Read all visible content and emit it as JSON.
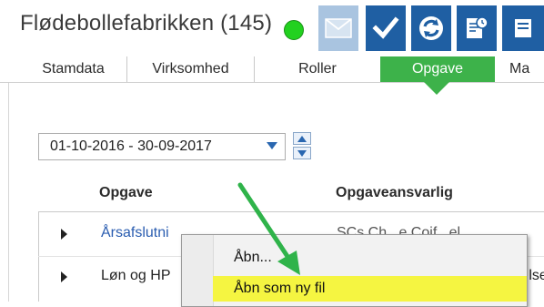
{
  "header": {
    "title": "Flødebollefabrikken (145)",
    "status_color": "#22d11f",
    "toolbar": [
      {
        "icon": "envelope-icon",
        "enabled": false
      },
      {
        "icon": "checkmark-icon",
        "enabled": true
      },
      {
        "icon": "refresh-icon",
        "enabled": true
      },
      {
        "icon": "report-clock-icon",
        "enabled": true
      },
      {
        "icon": "more-icon",
        "enabled": true
      }
    ]
  },
  "tabs": [
    {
      "label": "Stamdata",
      "active": false
    },
    {
      "label": "Virksomhed",
      "active": false
    },
    {
      "label": "Roller",
      "active": false
    },
    {
      "label": "Opgave",
      "active": true
    },
    {
      "label": "Ma",
      "active": false
    }
  ],
  "period": {
    "value": "01-10-2016 - 30-09-2017"
  },
  "grid": {
    "columns": [
      "Opgave",
      "Opgaveansvarlig"
    ],
    "rows": [
      {
        "task": "Årsafslutni",
        "owner": "SCs Ch...e Coif...el...",
        "link": true
      },
      {
        "task": "Løn og HP",
        "owner": "...lse",
        "link": false
      }
    ]
  },
  "context_menu": {
    "items": [
      {
        "label": "Åbn...",
        "highlighted": false
      },
      {
        "label": "Åbn som ny fil",
        "highlighted": true
      }
    ]
  },
  "colors": {
    "accent_green": "#3db24a",
    "toolbar_blue": "#1f5fa3",
    "highlight_yellow": "#f5f541",
    "annotation_arrow": "#2fb34a"
  }
}
